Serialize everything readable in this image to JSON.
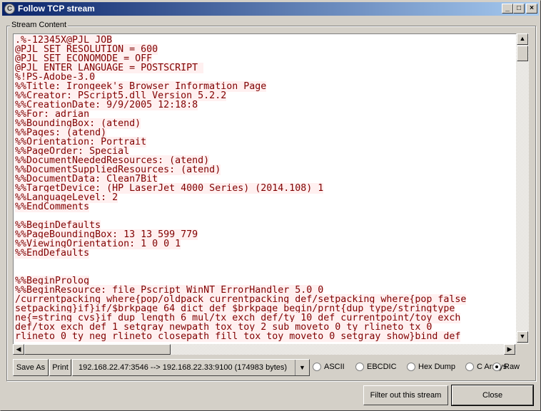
{
  "window": {
    "title": "Follow TCP stream"
  },
  "group_label": "Stream Content",
  "stream_lines": [
    ".%-12345X@PJL JOB",
    "@PJL SET RESOLUTION = 600",
    "@PJL SET ECONOMODE = OFF",
    "@PJL ENTER LANGUAGE = POSTSCRIPT ",
    "%!PS-Adobe-3.0",
    "%%Title: Irongeek's Browser Information Page",
    "%%Creator: PScript5.dll Version 5.2.2",
    "%%CreationDate: 9/9/2005 12:18:8",
    "%%For: adrian",
    "%%BoundingBox: (atend)",
    "%%Pages: (atend)",
    "%%Orientation: Portrait",
    "%%PageOrder: Special",
    "%%DocumentNeededResources: (atend)",
    "%%DocumentSuppliedResources: (atend)",
    "%%DocumentData: Clean7Bit",
    "%%TargetDevice: (HP LaserJet 4000 Series) (2014.108) 1",
    "%%LanguageLevel: 2",
    "%%EndComments",
    "",
    "%%BeginDefaults",
    "%%PageBoundingBox: 13 13 599 779",
    "%%ViewingOrientation: 1 0 0 1",
    "%%EndDefaults",
    "",
    "",
    "%%BeginProlog",
    "%%BeginResource: file Pscript_WinNT_ErrorHandler 5.0 0",
    "/currentpacking where{pop/oldpack currentpacking def/setpacking where{pop false",
    "setpacking}if}if/$brkpage 64 dict def $brkpage begin/prnt{dup type/stringtype",
    "ne{=string cvs}if dup length 6 mul/tx exch def/ty 10 def currentpoint/toy exch",
    "def/tox exch def 1 setgray newpath tox toy 2 sub moveto 0 ty rlineto tx 0",
    "rlineto 0 ty neg rlineto closepath fill tox toy moveto 0 setgray show}bind def"
  ],
  "toolbar": {
    "save_as": "Save As",
    "print": "Print",
    "stream_select": "192.168.22.47:3546 --> 192.168.22.33:9100 (174983 bytes)",
    "formats": [
      {
        "label": "ASCII",
        "selected": false
      },
      {
        "label": "EBCDIC",
        "selected": false
      },
      {
        "label": "Hex Dump",
        "selected": false
      },
      {
        "label": "C Arrays",
        "selected": false
      },
      {
        "label": "Raw",
        "selected": true
      }
    ]
  },
  "footer": {
    "filter": "Filter out this stream",
    "close": "Close"
  },
  "colors": {
    "stream_text": "#800000",
    "stream_bg": "#fff0f0",
    "titlebar": "#0a246a"
  }
}
